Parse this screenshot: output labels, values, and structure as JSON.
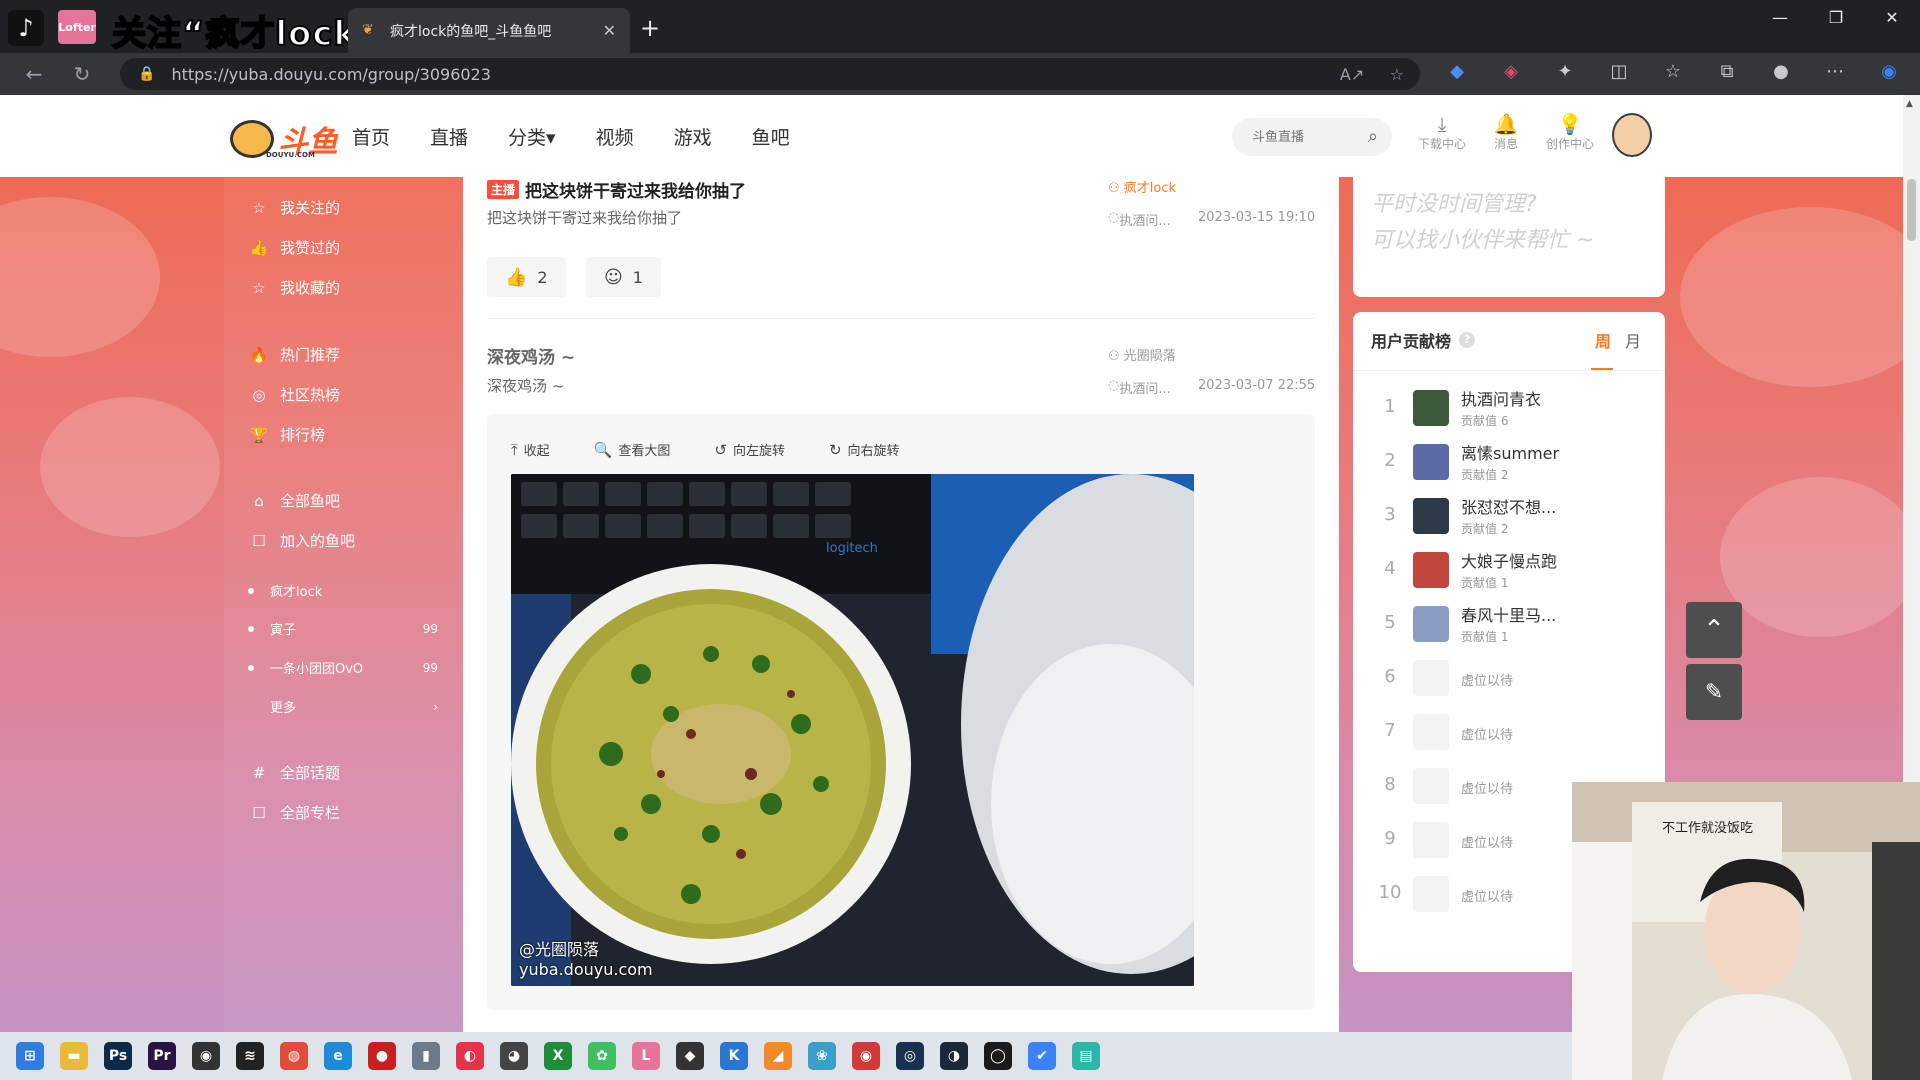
{
  "browser": {
    "pinned_tab_label": "Lofter",
    "overlay_text": "关注“疯才lock”",
    "active_tab_title": "疯才lock的鱼吧_斗鱼鱼吧",
    "url": "https://yuba.douyu.com/group/3096023",
    "new_tab": "+",
    "close": "✕"
  },
  "header": {
    "logo_text": "斗鱼",
    "logo_sub": "DOUYU.COM",
    "nav": [
      "首页",
      "直播",
      "分类▾",
      "视频",
      "游戏",
      "鱼吧"
    ],
    "search_placeholder": "斗鱼直播",
    "tools": [
      {
        "icon": "⤓",
        "label": "下载中心"
      },
      {
        "icon": "🔔",
        "label": "消息"
      },
      {
        "icon": "💡",
        "label": "创作中心"
      }
    ]
  },
  "sidebar": {
    "groups": [
      [
        {
          "icon": "☆",
          "label": "我关注的"
        },
        {
          "icon": "👍",
          "label": "我赞过的"
        },
        {
          "icon": "☆",
          "label": "我收藏的"
        }
      ],
      [
        {
          "icon": "🔥",
          "label": "热门推荐"
        },
        {
          "icon": "◎",
          "label": "社区热榜"
        },
        {
          "icon": "🏆",
          "label": "排行榜"
        }
      ],
      [
        {
          "icon": "⌂",
          "label": "全部鱼吧"
        },
        {
          "icon": "☐",
          "label": "加入的鱼吧"
        }
      ]
    ],
    "joined": [
      {
        "label": "疯才lock",
        "count": ""
      },
      {
        "label": "寅子",
        "count": "99"
      },
      {
        "label": "一条小团团OvO",
        "count": "99"
      }
    ],
    "more": "更多",
    "bottom": [
      {
        "icon": "#",
        "label": "全部话题"
      },
      {
        "icon": "☐",
        "label": "全部专栏"
      }
    ]
  },
  "feed": {
    "post1": {
      "tag": "主播",
      "title": "把这块饼干寄过来我给你抽了",
      "desc": "把这块饼干寄过来我给你抽了",
      "author": "疯才lock",
      "replier": "执酒问...",
      "time": "2023-03-15 19:10",
      "likes": "2",
      "comments": "1"
    },
    "post2": {
      "title": "深夜鸡汤 ~",
      "desc": "深夜鸡汤 ~",
      "author": "光圈陨落",
      "replier": "执酒问...",
      "time": "2023-03-07 22:55"
    },
    "image_tools": [
      {
        "icon": "⤒",
        "label": "收起"
      },
      {
        "icon": "🔍",
        "label": "查看大图"
      },
      {
        "icon": "↺",
        "label": "向左旋转"
      },
      {
        "icon": "↻",
        "label": "向右旋转"
      }
    ],
    "watermark_user": "@光圈陨落",
    "watermark_site": "yuba.douyu.com",
    "keyboard_brand": "logitech"
  },
  "promo": {
    "line1": "平时没时间管理?",
    "line2": "可以找小伙伴来帮忙 ~"
  },
  "ranking": {
    "title": "用户贡献榜",
    "help": "?",
    "tab_week": "周",
    "tab_month": "月",
    "score_label": "贡献值",
    "rows": [
      {
        "no": "1",
        "name": "执酒问青衣",
        "score": "6",
        "color": "#3d5a3a"
      },
      {
        "no": "2",
        "name": "离愫summer",
        "score": "2",
        "color": "#5c6aa8"
      },
      {
        "no": "3",
        "name": "张怼怼不想...",
        "score": "2",
        "color": "#2d3a48"
      },
      {
        "no": "4",
        "name": "大娘子慢点跑",
        "score": "1",
        "color": "#c0463e"
      },
      {
        "no": "5",
        "name": "春风十里马...",
        "score": "1",
        "color": "#8a9dc2"
      },
      {
        "no": "6",
        "placeholder": "虚位以待"
      },
      {
        "no": "7",
        "placeholder": "虚位以待"
      },
      {
        "no": "8",
        "placeholder": "虚位以待"
      },
      {
        "no": "9",
        "placeholder": "虚位以待"
      },
      {
        "no": "10",
        "placeholder": "虚位以待"
      }
    ]
  },
  "float": {
    "up": "⌃",
    "edit": "✎"
  },
  "webcam": {
    "sign_text": "不工作就没饭吃"
  },
  "taskbar": [
    {
      "icon": "⊞",
      "color": "#2f7de1"
    },
    {
      "icon": "▬",
      "color": "#e8b93a"
    },
    {
      "icon": "Ps",
      "color": "#0b2a4a"
    },
    {
      "icon": "Pr",
      "color": "#2a1244"
    },
    {
      "icon": "◉",
      "color": "#333"
    },
    {
      "icon": "≋",
      "color": "#222"
    },
    {
      "icon": "◍",
      "color": "#e14b3b"
    },
    {
      "icon": "e",
      "color": "#1f8ad6"
    },
    {
      "icon": "●",
      "color": "#c82020"
    },
    {
      "icon": "▮",
      "color": "#6c7a8a"
    },
    {
      "icon": "◐",
      "color": "#e6334b"
    },
    {
      "icon": "◕",
      "color": "#444"
    },
    {
      "icon": "X",
      "color": "#1e8d3a"
    },
    {
      "icon": "✿",
      "color": "#3fbf5f"
    },
    {
      "icon": "L",
      "color": "#e6749a"
    },
    {
      "icon": "◆",
      "color": "#333"
    },
    {
      "icon": "K",
      "color": "#2a76d2"
    },
    {
      "icon": "◢",
      "color": "#f08a2a"
    },
    {
      "icon": "❀",
      "color": "#3aa0c8"
    },
    {
      "icon": "◉",
      "color": "#d23a3a"
    },
    {
      "icon": "◎",
      "color": "#1a3050"
    },
    {
      "icon": "◑",
      "color": "#1b2838"
    },
    {
      "icon": "◯",
      "color": "#1a1a1a"
    },
    {
      "icon": "✔",
      "color": "#3b82f6"
    },
    {
      "icon": "▤",
      "color": "#2bb6a8"
    }
  ]
}
